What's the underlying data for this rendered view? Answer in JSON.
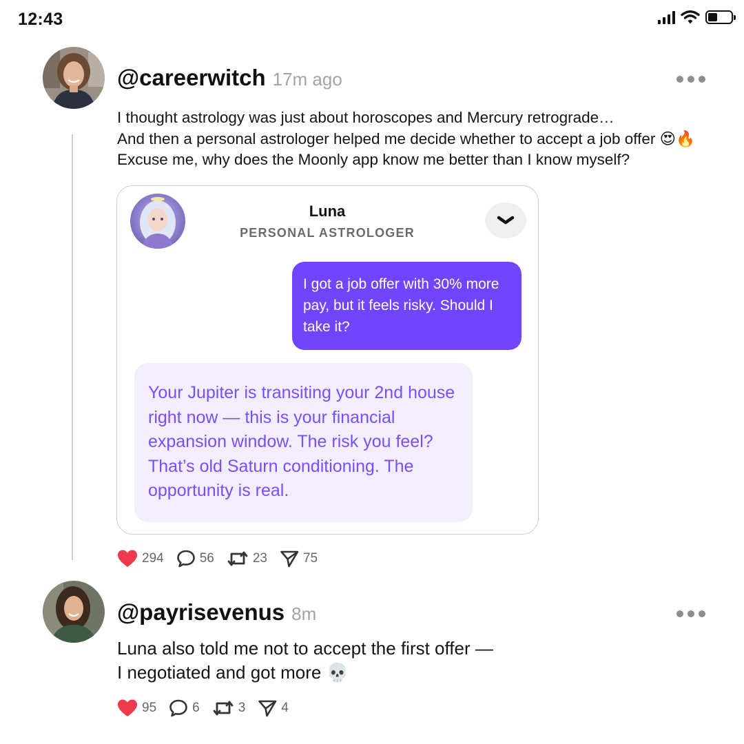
{
  "status_bar": {
    "time": "12:43"
  },
  "posts": [
    {
      "username": "@careerwitch",
      "time_ago": "17m ago",
      "text_lines": [
        "I thought astrology was just about horoscopes and Mercury retrograde…",
        "And then a personal astrologer helped me decide whether to accept a job offer 😍🔥",
        "Excuse me, why does the Moonly app know me better than I know myself?"
      ],
      "embed": {
        "name": "Luna",
        "role": "PERSONAL ASTROLOGER",
        "user_message": "I got a job offer with 30% more pay, but it feels risky. Should I take it?",
        "bot_message": "Your Jupiter is transiting your 2nd house right now — this is your financial expansion window. The risk you feel? That’s old Saturn conditioning. The opportunity is real."
      },
      "stats": {
        "likes": "294",
        "comments": "56",
        "reposts": "23",
        "shares": "75"
      }
    },
    {
      "username": "@payrisevenus",
      "time_ago": "8m",
      "text_lines": [
        "Luna also told me not to accept the first offer —",
        "I negotiated and got more 💀"
      ],
      "stats": {
        "likes": "95",
        "comments": "6",
        "reposts": "3",
        "shares": "4"
      }
    }
  ],
  "colors": {
    "accent": "#7144ff",
    "bot_bubble": "#f2eefd",
    "bot_text": "#7b4dff",
    "like": "#ee3a4c"
  },
  "icons": [
    "signal-icon",
    "wifi-icon",
    "battery-icon",
    "more-icon",
    "chevron-down-icon",
    "heart-icon",
    "comment-icon",
    "repost-icon",
    "share-icon"
  ]
}
